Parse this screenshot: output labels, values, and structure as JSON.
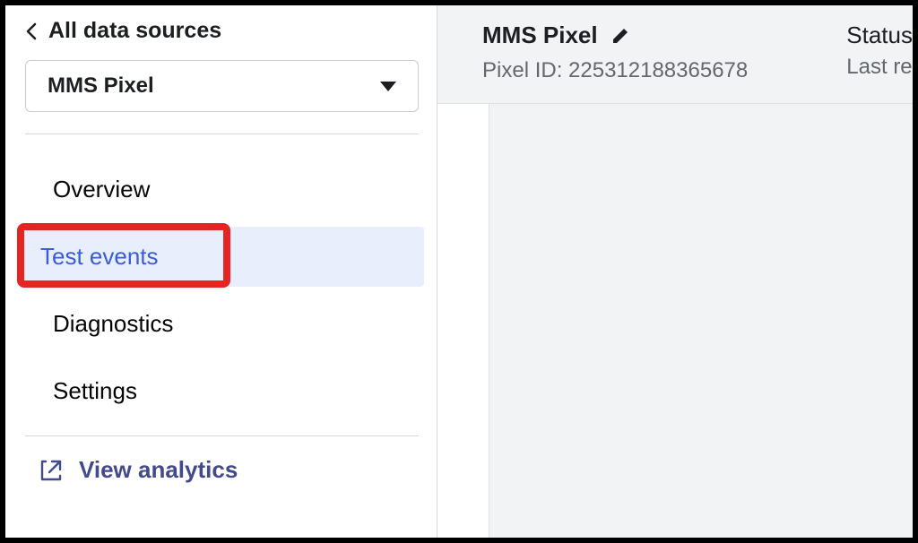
{
  "sidebar": {
    "back_label": "All data sources",
    "selector_label": "MMS Pixel",
    "nav": {
      "overview": "Overview",
      "test_events": "Test events",
      "diagnostics": "Diagnostics",
      "settings": "Settings"
    },
    "view_analytics": "View analytics"
  },
  "header": {
    "title": "MMS Pixel",
    "pixel_id_label": "Pixel ID: 225312188365678",
    "status_label": "Status",
    "lastre_label": "Last re"
  },
  "annotation": {
    "highlighted_item": "test_events"
  }
}
